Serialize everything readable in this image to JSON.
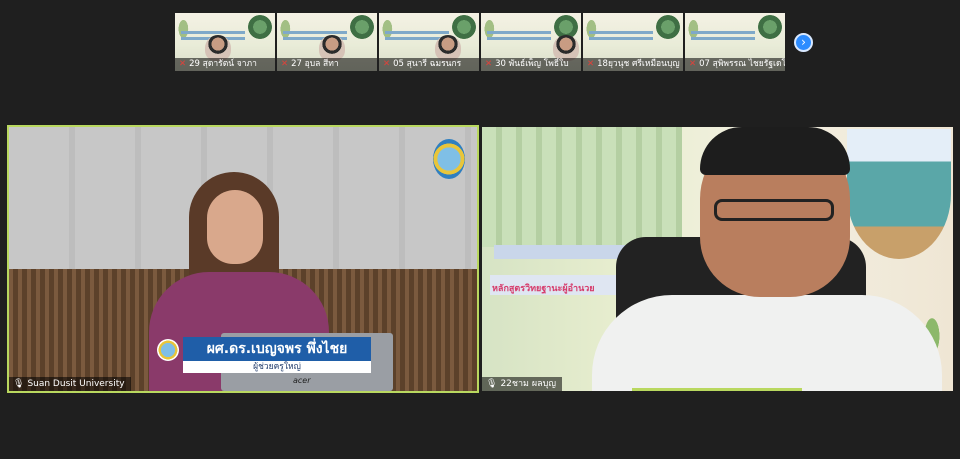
{
  "gallery": {
    "participants": [
      {
        "label": "29 สุดารัตน์  จาภา"
      },
      {
        "label": "27 อุบล สีทา"
      },
      {
        "label": "05 สุนารี ฉมรนกร"
      },
      {
        "label": "30 พันธ์เพ็ญ   โพธิ์ใบ"
      },
      {
        "label": "18ยุวนุช ศรีเหมือนบุญ"
      },
      {
        "label": "07 สุพิพรรณ ไชยรัฐเดโช..."
      }
    ],
    "next_icon": "chevron-right-icon"
  },
  "main_video": {
    "name_overlay": "ผศ.ดร.เบญจพร พึ่งไชย",
    "title_overlay": "ผู้ช่วยครูใหญ่",
    "laptop_brand": "acer",
    "participant_label": "Suan Dusit University"
  },
  "second_video": {
    "banner_text": "หลักสูตรวิทยฐานะผู้อำนวย",
    "participant_label": "22ชาม  ผลบุญ"
  },
  "colors": {
    "active_speaker_border": "#b9d85f",
    "next_button": "#2d8cff",
    "background": "#1f1f1f"
  }
}
